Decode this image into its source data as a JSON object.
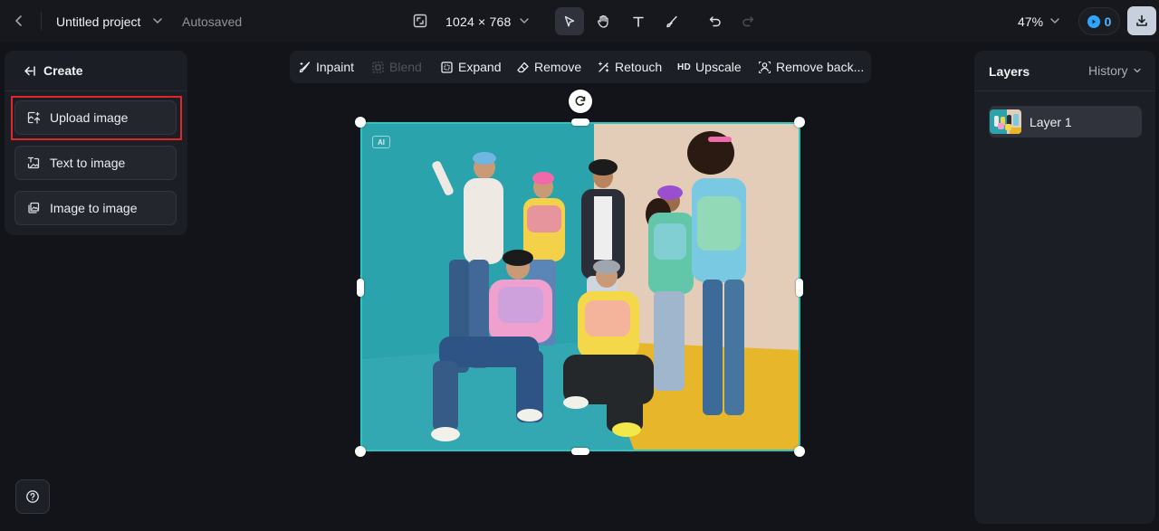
{
  "topbar": {
    "project_title": "Untitled project",
    "autosave_status": "Autosaved",
    "canvas_size": "1024 × 768",
    "zoom": "47%",
    "credits": "0"
  },
  "left_panel": {
    "header": "Create",
    "buttons": [
      {
        "label": "Upload image",
        "icon": "upload-image-icon"
      },
      {
        "label": "Text to image",
        "icon": "text-to-image-icon"
      },
      {
        "label": "Image to image",
        "icon": "image-to-image-icon"
      }
    ]
  },
  "edit_toolbar": {
    "inpaint": "Inpaint",
    "blend": "Blend",
    "expand": "Expand",
    "remove": "Remove",
    "retouch": "Retouch",
    "upscale_badge": "HD",
    "upscale": "Upscale",
    "remove_background": "Remove back..."
  },
  "canvas": {
    "ai_badge": "AI"
  },
  "right_panel": {
    "title": "Layers",
    "history": "History",
    "layers": [
      {
        "name": "Layer 1"
      }
    ]
  },
  "colors": {
    "background": "#121419",
    "panel": "#1b1e24",
    "selection": "#2ac6bf",
    "highlight": "#e0262b",
    "credit_accent": "#2aa7ff"
  }
}
